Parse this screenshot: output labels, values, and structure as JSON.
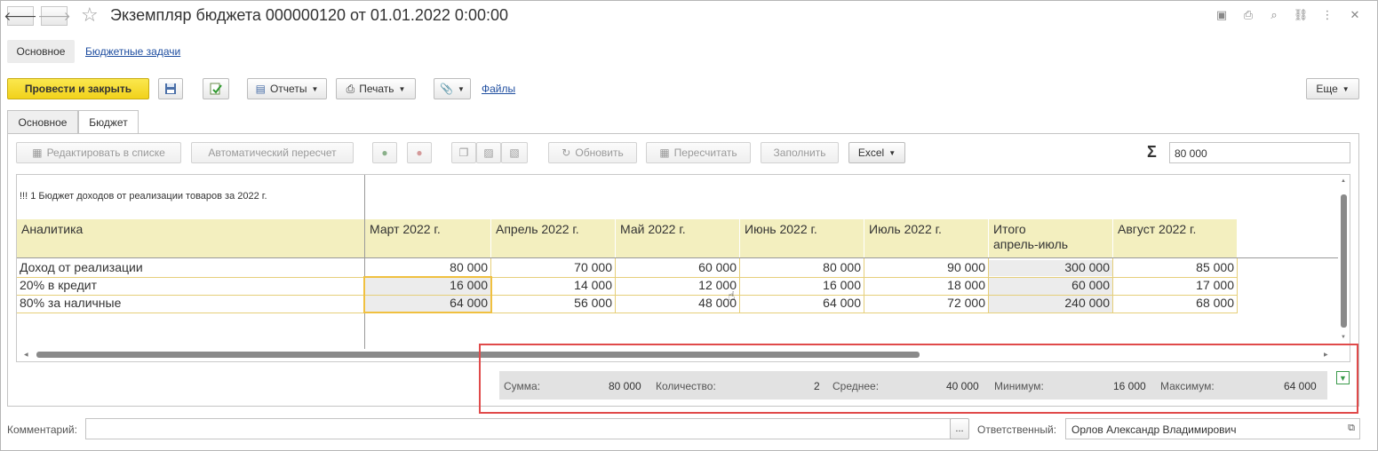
{
  "window": {
    "title": "Экземпляр бюджета 000000120 от 01.01.2022 0:00:00",
    "nav_back": "🡐",
    "nav_forward": "🡒"
  },
  "sections": {
    "main": "Основное",
    "tasks_link": "Бюджетные задачи"
  },
  "toolbar": {
    "post_close": "Провести и закрыть",
    "reports": "Отчеты",
    "print": "Печать",
    "files": "Файлы",
    "more": "Еще"
  },
  "tabs": [
    {
      "label": "Основное",
      "active": false
    },
    {
      "label": "Бюджет",
      "active": true
    }
  ],
  "sheet_toolbar": {
    "edit_list": "Редактировать в списке",
    "auto_recalc": "Автоматический пересчет",
    "refresh": "Обновить",
    "recalc": "Пересчитать",
    "fill": "Заполнить",
    "excel": "Excel",
    "sum_symbol": "Σ",
    "sum_value": "80 000"
  },
  "sheet": {
    "caption": "!!! 1 Бюджет доходов от реализации товаров за 2022 г.",
    "columns": [
      "Аналитика",
      "Март 2022 г.",
      "Апрель 2022 г.",
      "Май 2022 г.",
      "Июнь 2022 г.",
      "Июль 2022 г.",
      "Итого\nапрель-июль",
      "Август 2022 г."
    ],
    "rows": [
      {
        "label": "Доход от реализации",
        "values": [
          "80 000",
          "70 000",
          "60 000",
          "80 000",
          "90 000",
          "300 000",
          "85 000"
        ]
      },
      {
        "label": "20% в кредит",
        "values": [
          "16 000",
          "14 000",
          "12 000",
          "16 000",
          "18 000",
          "60 000",
          "17 000"
        ]
      },
      {
        "label": "80% за наличные",
        "values": [
          "64 000",
          "56 000",
          "48 000",
          "64 000",
          "72 000",
          "240 000",
          "68 000"
        ]
      }
    ]
  },
  "stats": {
    "sum_label": "Сумма:",
    "sum_value": "80 000",
    "count_label": "Количество:",
    "count_value": "2",
    "avg_label": "Среднее:",
    "avg_value": "40 000",
    "min_label": "Минимум:",
    "min_value": "16 000",
    "max_label": "Максимум:",
    "max_value": "64 000"
  },
  "footer": {
    "comment_label": "Комментарий:",
    "comment_value": "",
    "comment_btn": "...",
    "responsible_label": "Ответственный:",
    "responsible_value": "Орлов Александр Владимирович"
  },
  "colors": {
    "header_fill": "#f3efbf",
    "selection_border": "#f0c040",
    "highlight_border": "#e04a4a",
    "primary_button": "#f1d21b"
  }
}
